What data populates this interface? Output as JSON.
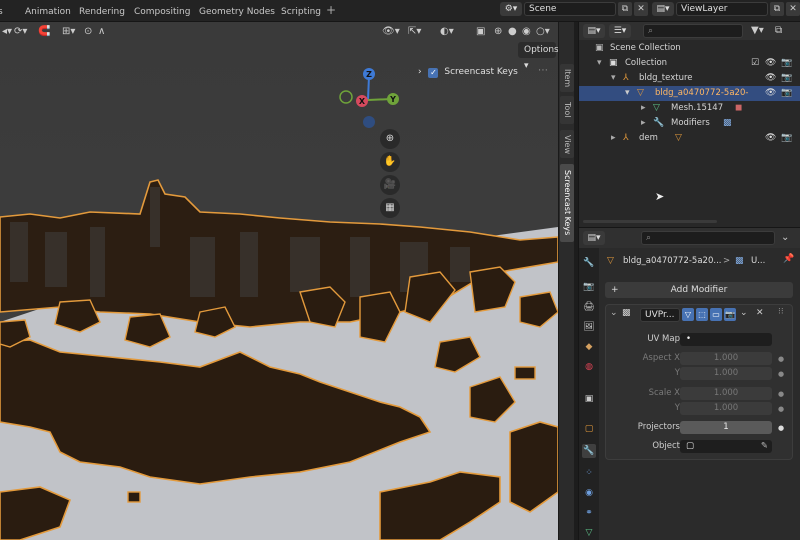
{
  "topbar": {
    "tabs": [
      "Animation",
      "Rendering",
      "Compositing",
      "Geometry Nodes",
      "Scripting"
    ],
    "add_tab": "+",
    "scene": "Scene",
    "view_layer": "ViewLayer"
  },
  "viewport": {
    "options_label": "Options",
    "screencast_keys_label": "Screencast Keys",
    "gizmo": {
      "z": "Z",
      "y": "Y",
      "x": "X"
    }
  },
  "side_tabs": [
    "Item",
    "Tool",
    "View",
    "Screencast Keys"
  ],
  "outliner": {
    "rows": [
      {
        "label": "Scene Collection",
        "indent": 0
      },
      {
        "label": "Collection",
        "indent": 1
      },
      {
        "label": "bldg_texture",
        "indent": 2
      },
      {
        "label": "bldg_a0470772-5a20-",
        "indent": 3,
        "selected": true
      },
      {
        "label": "Mesh.15147",
        "indent": 4
      },
      {
        "label": "Modifiers",
        "indent": 4
      },
      {
        "label": "dem",
        "indent": 2
      }
    ]
  },
  "properties": {
    "breadcrumb_object": "bldg_a0470772-5a20...",
    "breadcrumb_sep": ">",
    "breadcrumb_modifier": "U...",
    "add_modifier_label": "Add Modifier",
    "modifier": {
      "name": "UVPr...",
      "uv_map_label": "UV Map",
      "uv_map_value": "•",
      "aspect_x_label": "Aspect X",
      "aspect_x": "1.000",
      "aspect_y_label": "Y",
      "aspect_y": "1.000",
      "scale_x_label": "Scale X",
      "scale_x": "1.000",
      "scale_y_label": "Y",
      "scale_y": "1.000",
      "projectors_label": "Projectors",
      "projectors": "1",
      "object_label": "Object"
    }
  },
  "colors": {
    "selection": "#334d80",
    "accent_blue": "#4772b3",
    "building": "#2a1c10",
    "outline": "#e39a3c",
    "ground": "#c1c3c8"
  }
}
